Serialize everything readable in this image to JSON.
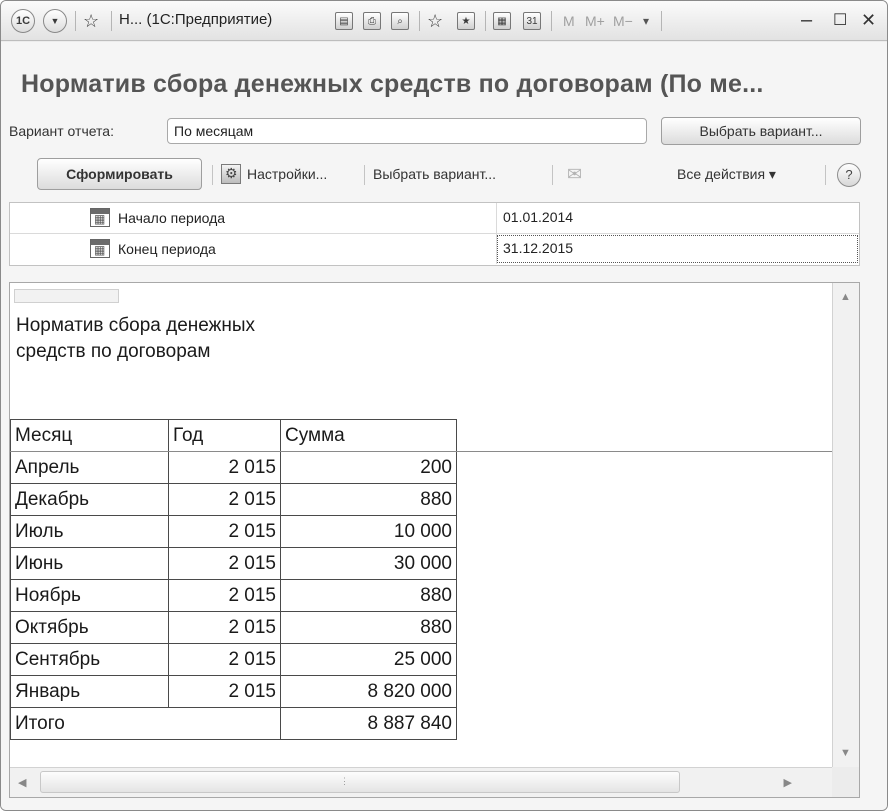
{
  "titlebar": {
    "app_icon": "1c-logo-icon",
    "app_icon_text": "1С",
    "menu_icon": "chevron-down-icon",
    "title": "Н...  (1С:Предприятие)",
    "buttons": [
      "save-icon",
      "print-icon",
      "preview-icon",
      "favorite-icon",
      "bookmark-icon",
      "calculator-icon",
      "calendar-icon"
    ],
    "calendar_day": "31",
    "memory": [
      "M",
      "M+",
      "M−"
    ],
    "window_controls": [
      "minimize-icon",
      "maximize-icon",
      "close-icon"
    ]
  },
  "form": {
    "heading": "Норматив сбора денежных средств по договорам (По ме...",
    "variant_label": "Вариант отчета:",
    "variant_value": "По месяцам",
    "choose_variant_button": "Выбрать вариант..."
  },
  "toolbar": {
    "generate": "Сформировать",
    "settings": "Настройки...",
    "choose_variant": "Выбрать вариант...",
    "all_actions": "Все действия ▾",
    "help": "?"
  },
  "params": [
    {
      "label": "Начало периода",
      "value": "01.01.2014"
    },
    {
      "label": "Конец периода",
      "value": "31.12.2015"
    }
  ],
  "report": {
    "title": "Норматив сбора денежных средств по договорам",
    "columns": [
      "Месяц",
      "Год",
      "Сумма"
    ],
    "rows": [
      {
        "month": "Апрель",
        "year": "2 015",
        "sum": "200"
      },
      {
        "month": "Декабрь",
        "year": "2 015",
        "sum": "880"
      },
      {
        "month": "Июль",
        "year": "2 015",
        "sum": "10 000"
      },
      {
        "month": "Июнь",
        "year": "2 015",
        "sum": "30 000"
      },
      {
        "month": "Ноябрь",
        "year": "2 015",
        "sum": "880"
      },
      {
        "month": "Октябрь",
        "year": "2 015",
        "sum": "880"
      },
      {
        "month": "Сентябрь",
        "year": "2 015",
        "sum": "25 000"
      },
      {
        "month": "Январь",
        "year": "2 015",
        "sum": "8 820 000"
      }
    ],
    "total_label": "Итого",
    "total_value": "8 887 840"
  },
  "colors": {
    "heading": "#555555",
    "window_bg": "#f5f5f5"
  }
}
